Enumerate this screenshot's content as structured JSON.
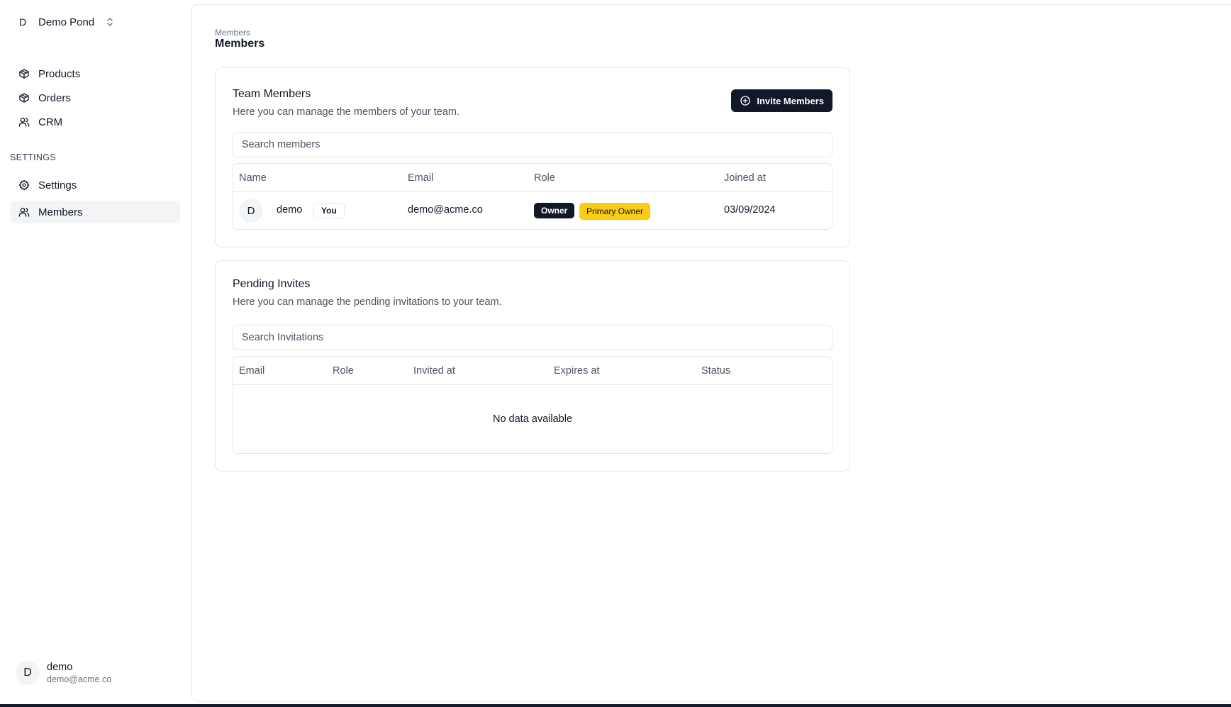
{
  "team": {
    "avatar_initial": "D",
    "name": "Demo Pond"
  },
  "sidebar": {
    "items": [
      {
        "label": "Products"
      },
      {
        "label": "Orders"
      },
      {
        "label": "CRM"
      }
    ],
    "settings_section_label": "SETTINGS",
    "settings_items": [
      {
        "label": "Settings"
      },
      {
        "label": "Members",
        "active": true
      }
    ]
  },
  "user": {
    "avatar_initial": "D",
    "name": "demo",
    "email": "demo@acme.co"
  },
  "page": {
    "breadcrumb": "Members",
    "title": "Members"
  },
  "team_members": {
    "title": "Team Members",
    "subtitle": "Here you can manage the members of your team.",
    "invite_button_label": "Invite Members",
    "search_placeholder": "Search members",
    "columns": [
      "Name",
      "Email",
      "Role",
      "Joined at"
    ],
    "rows": [
      {
        "avatar_initial": "D",
        "name": "demo",
        "you_badge": "You",
        "email": "demo@acme.co",
        "role": "Owner",
        "role_badge_2": "Primary Owner",
        "joined_at": "03/09/2024"
      }
    ]
  },
  "pending_invites": {
    "title": "Pending Invites",
    "subtitle": "Here you can manage the pending invitations to your team.",
    "search_placeholder": "Search Invitations",
    "columns": [
      "Email",
      "Role",
      "Invited at",
      "Expires at",
      "Status"
    ],
    "empty_text": "No data available"
  },
  "colors": {
    "primary": "#111827",
    "accent_badge": "#facc15",
    "border": "#e5e7eb",
    "muted_text": "#4b5563",
    "active_nav_bg": "#f3f4f6"
  },
  "icons": {
    "team_switcher": "chevron-up-down-icon",
    "products": "box-icon",
    "orders": "box-icon",
    "crm": "users-icon",
    "settings": "gear-icon",
    "members": "users-icon",
    "invite": "plus-circle-icon"
  }
}
